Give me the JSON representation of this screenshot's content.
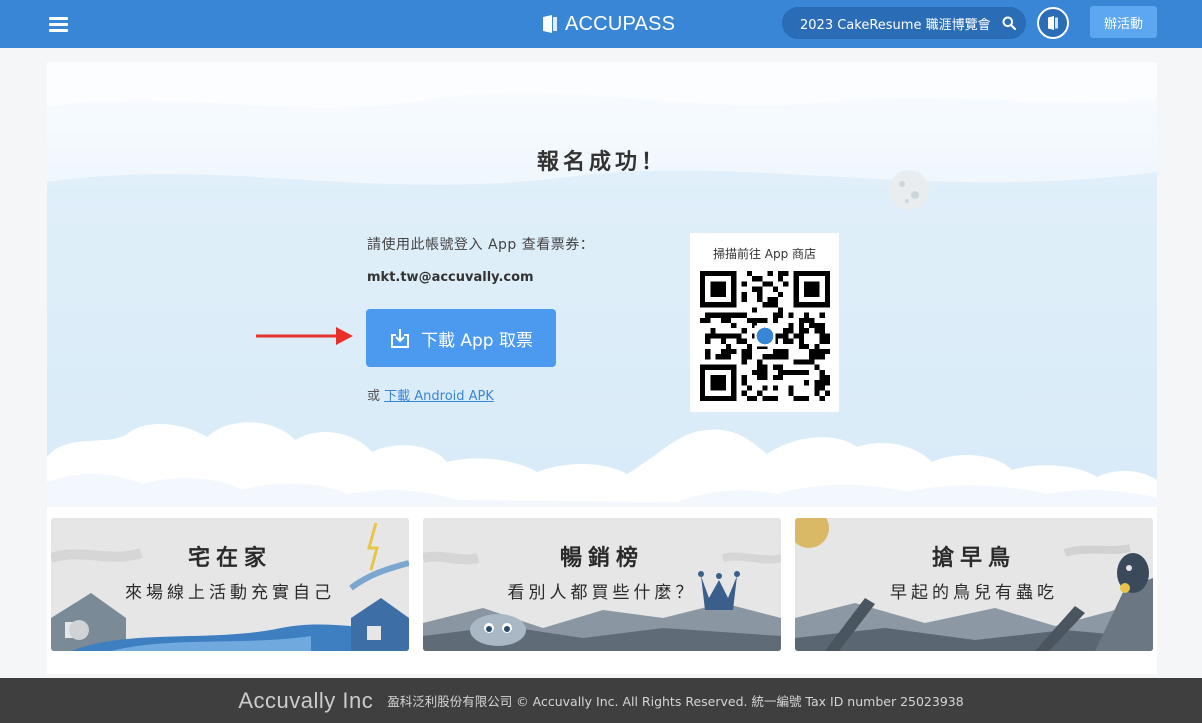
{
  "header": {
    "brand": "ACCUPASS",
    "search_query": "2023 CakeResume 職涯博覽會",
    "host_button": "辦活動"
  },
  "main": {
    "title": "報名成功！",
    "instruction": "請使用此帳號登入 App 查看票券：",
    "email": "mkt.tw@accuvally.com",
    "download_button": "下載 App 取票",
    "alt_prefix": "或 ",
    "alt_link": "下載 Android APK",
    "qr_label": "掃描前往 App 商店"
  },
  "banners": [
    {
      "title": "宅在家",
      "subtitle": "來場線上活動充實自己"
    },
    {
      "title": "暢銷榜",
      "subtitle": "看別人都買些什麼？"
    },
    {
      "title": "搶早鳥",
      "subtitle": "早起的鳥兒有蟲吃"
    }
  ],
  "footer": {
    "brand": "Accuvally Inc",
    "text": "盈科泛利股份有限公司 © Accuvally Inc. All Rights Reserved. 統一編號 Tax ID number 25023938"
  },
  "colors": {
    "header_bg": "#3a86d6",
    "search_bg": "#2a6cb6",
    "host_button_bg": "#5da6f0",
    "download_button_bg": "#4b9af0",
    "arrow": "#e8302a",
    "footer_bg": "#3f3f3f"
  },
  "icons": [
    "menu-icon",
    "accupass-logo-icon",
    "search-icon",
    "ticket-icon",
    "download-icon",
    "arrow-right-icon",
    "qr-code",
    "moon-icon"
  ]
}
